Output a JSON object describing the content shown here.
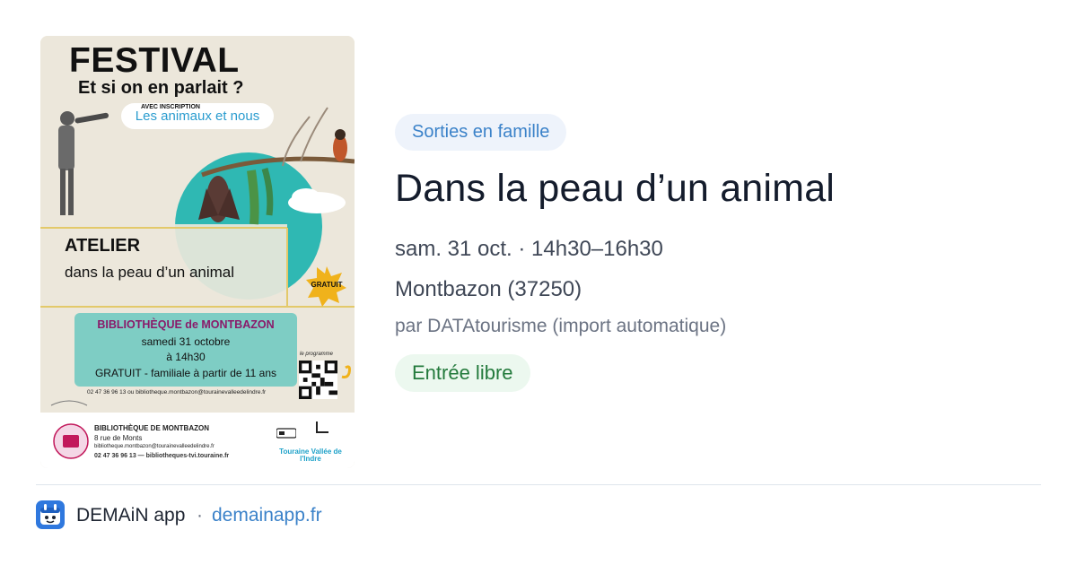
{
  "poster": {
    "festival": "FESTIVAL",
    "subtitle": "Et si on en parlait ?",
    "theme": "Les animaux et nous",
    "atelier": "ATELIER",
    "atelier_sub": "dans la peau d’un animal",
    "gratuit_badge": "GRATUIT",
    "venue": "BIBLIOTHÈQUE de MONTBAZON",
    "date": "samedi 31 octobre",
    "time": "à 14h30",
    "price_info": "GRATUIT - familiale à partir de 11 ans",
    "registration": "AVEC INSCRIPTION",
    "contact": "02 47 36 96 13 ou bibliotheque.montbazon@tourainevalleedelindre.fr",
    "qr_label": "le programme",
    "footer_name": "BIBLIOTHÈQUE DE MONTBAZON",
    "footer_address": "8 rue de Monts",
    "footer_email": "bibliotheque.montbazon@tourainevalleedelindre.fr",
    "footer_phone": "02 47 36 96 13 — bibliotheques-tvi.touraine.fr",
    "footer_logo_text": "Touraine Vallée de l'Indre"
  },
  "event": {
    "category": "Sorties en famille",
    "title": "Dans la peau d’un animal",
    "datetime": "sam. 31 oct. · 14h30–16h30",
    "location": "Montbazon (37250)",
    "organizer": "par DATAtourisme (import automatique)",
    "price": "Entrée libre"
  },
  "footer": {
    "app_name": "DEMAiN app",
    "separator": "·",
    "domain": "demainapp.fr"
  },
  "colors": {
    "tag_bg": "#eef3fb",
    "tag_text": "#3b82c9",
    "price_bg": "#ecf8ef",
    "price_text": "#237a3c",
    "title_text": "#141c2c",
    "link": "#3b82c9",
    "poster_teal": "#2fb8b3"
  }
}
